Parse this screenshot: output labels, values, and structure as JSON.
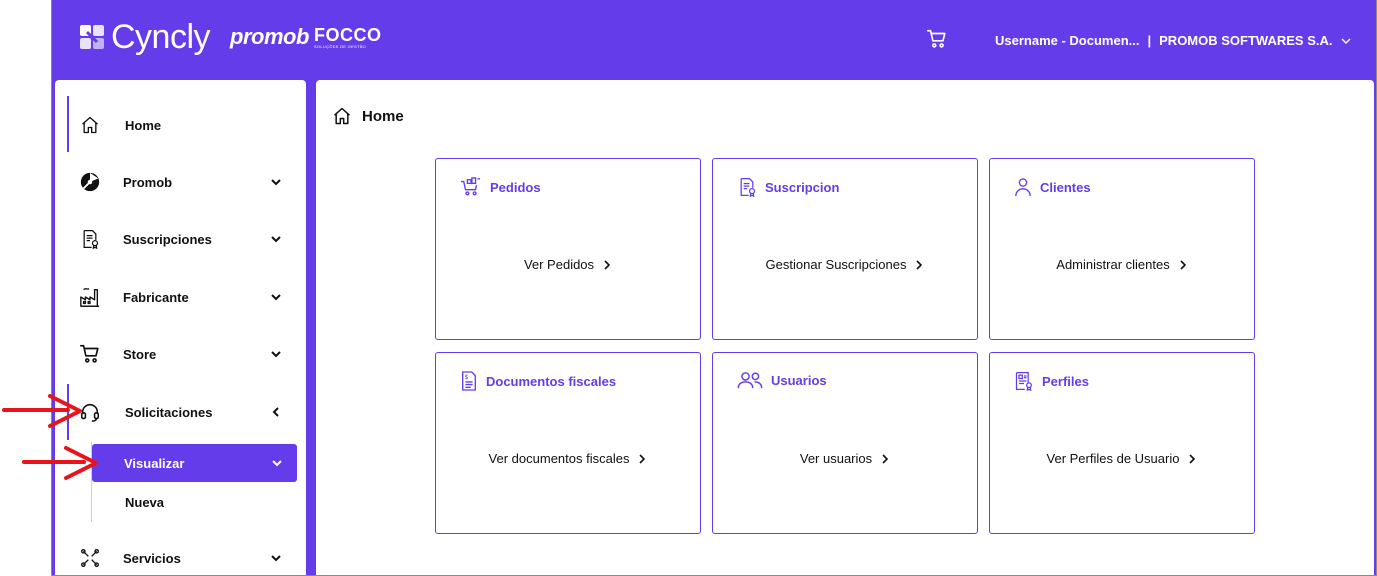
{
  "header": {
    "brand": "Cyncly",
    "brand2": "promob",
    "brand3": "FOCCO",
    "brand3_sub": "SOLUÇÕES DE GESTÃO",
    "user": "Username - Documen...",
    "separator": "|",
    "company": "PROMOB SOFTWARES S.A."
  },
  "sidebar": {
    "items": [
      {
        "label": "Home",
        "icon": "home-icon"
      },
      {
        "label": "Promob",
        "icon": "promob-icon"
      },
      {
        "label": "Suscripciones",
        "icon": "subscription-icon"
      },
      {
        "label": "Fabricante",
        "icon": "factory-icon"
      },
      {
        "label": "Store",
        "icon": "cart-icon"
      },
      {
        "label": "Solicitaciones",
        "icon": "headset-icon"
      },
      {
        "label": "Servicios",
        "icon": "tools-icon"
      }
    ],
    "sub_items": [
      {
        "label": "Visualizar"
      },
      {
        "label": "Nueva"
      }
    ]
  },
  "main": {
    "title": "Home",
    "cards": [
      {
        "title": "Pedidos",
        "link": "Ver Pedidos",
        "icon": "orders-cart-icon"
      },
      {
        "title": "Suscripcion",
        "link": "Gestionar Suscripciones",
        "icon": "subscription-icon"
      },
      {
        "title": "Clientes",
        "link": "Administrar clientes",
        "icon": "user-icon"
      },
      {
        "title": "Documentos fiscales",
        "link": "Ver documentos fiscales",
        "icon": "fiscal-document-icon"
      },
      {
        "title": "Usuarios",
        "link": "Ver usuarios",
        "icon": "users-icon"
      },
      {
        "title": "Perfiles",
        "link": "Ver Perfiles de Usuario",
        "icon": "profile-icon"
      }
    ]
  },
  "colors": {
    "accent": "#653ce9",
    "annotation": "#e8141c"
  }
}
